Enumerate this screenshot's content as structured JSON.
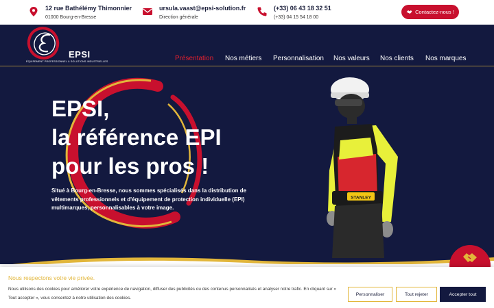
{
  "contact_bar": {
    "address": {
      "line1": "12 rue Bathélémy Thimonnier",
      "line2": "01000 Bourg-en-Bresse",
      "icon": "map-pin-icon"
    },
    "email": {
      "line1": "ursula.vaast@epsi-solution.fr",
      "line2": "Direction générale",
      "icon": "envelope-icon"
    },
    "phone": {
      "line1": "(+33) 06 43 18 32 51",
      "line2": "(+33) 04 15 54 18 00",
      "icon": "phone-icon"
    },
    "cta_label": "Contactez-nous !"
  },
  "logo": {
    "word": "EPSI",
    "tagline": "ÉQUIPEMENT PROFESSIONNEL & SOLUTIONS INDUSTRIELLES"
  },
  "nav": {
    "items": [
      {
        "label": "Présentation",
        "active": true
      },
      {
        "label": "Nos métiers",
        "active": false
      },
      {
        "label": "Personnalisation",
        "active": false
      },
      {
        "label": "Nos valeurs",
        "active": false
      },
      {
        "label": "Nos clients",
        "active": false
      },
      {
        "label": "Nos marques",
        "active": false
      }
    ]
  },
  "hero": {
    "title_line1": "EPSI,",
    "title_line2": "la référence EPI",
    "title_line3": "pour les pros !",
    "description": "Situé à Bourg-en-Bresse, nous sommes spécialisés dans la distribution de vêtements professionnels et d'équipement de protection individuelle (EPI) multimarques, personnalisables à votre image.",
    "belt_brand": "STANLEY"
  },
  "cookie": {
    "title": "Nous respectons votre vie privée.",
    "text": "Nous utilisons des cookies pour améliorer votre expérience de navigation, diffuser des publicités ou des contenus personnalisés et analyser notre trafic. En cliquant sur « Tout accepter », vous consentez à notre utilisation des cookies.",
    "customize_label": "Personnaliser",
    "reject_label": "Tout rejeter",
    "accept_label": "Accepter tout"
  },
  "colors": {
    "navy": "#13193f",
    "red": "#c8102e",
    "gold": "#e2b63a",
    "white": "#ffffff"
  }
}
